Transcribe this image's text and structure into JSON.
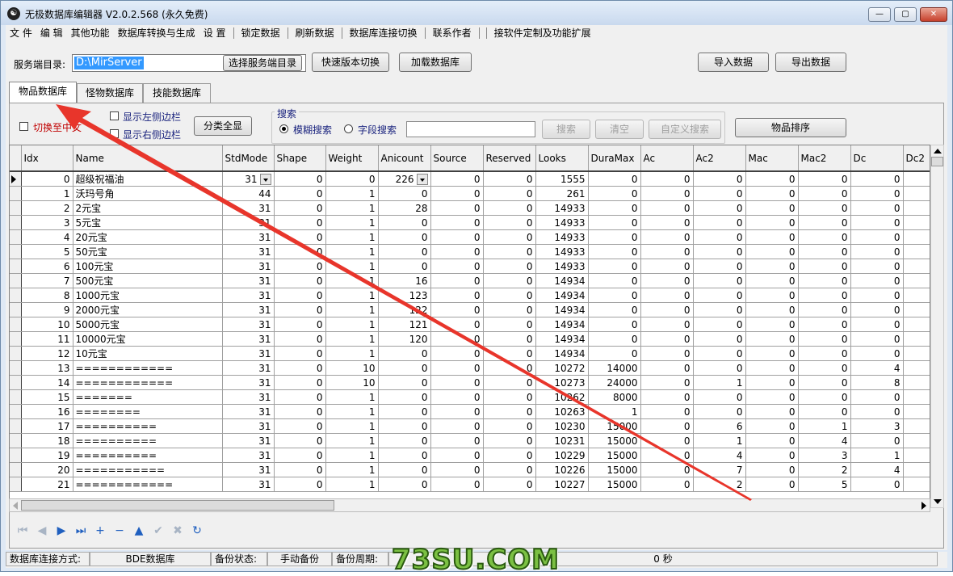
{
  "window": {
    "title": "无极数据库编辑器 V2.0.2.568 (永久免费)",
    "icon_glyph": "☯",
    "min": "—",
    "max": "▢",
    "close": "✕"
  },
  "menu": [
    "文 件",
    "编 辑",
    "其他功能",
    "数据库转换与生成",
    "设 置",
    "|",
    "锁定数据",
    "|",
    "刷新数据",
    "|",
    "数据库连接切换",
    "|",
    "联系作者",
    "|",
    "|",
    "接软件定制及功能扩展"
  ],
  "toolbar": {
    "server_dir_label": "服务端目录:",
    "server_dir_value": "D:\\MirServer",
    "choose_dir": "选择服务端目录",
    "quick_switch": "快速版本切换",
    "load_db": "加载数据库",
    "import": "导入数据",
    "export": "导出数据"
  },
  "tabs": [
    "物品数据库",
    "怪物数据库",
    "技能数据库"
  ],
  "options": {
    "to_chinese": "切换至中文",
    "show_left": "显示左侧边栏",
    "show_right": "显示右侧边栏",
    "show_all": "分类全显"
  },
  "search": {
    "group": "搜索",
    "fuzzy": "模糊搜索",
    "field": "字段搜索",
    "search_btn": "搜索",
    "clear_btn": "清空",
    "custom_btn": "自定义搜索",
    "sort_btn": "物品排序"
  },
  "columns": [
    "Idx",
    "Name",
    "StdMode",
    "Shape",
    "Weight",
    "Anicount",
    "Source",
    "Reserved",
    "Looks",
    "DuraMax",
    "Ac",
    "Ac2",
    "Mac",
    "Mac2",
    "Dc",
    "Dc2"
  ],
  "rows": [
    [
      0,
      "超级祝福油",
      31,
      0,
      0,
      226,
      0,
      0,
      1555,
      0,
      0,
      0,
      0,
      0,
      0
    ],
    [
      1,
      "沃玛号角",
      44,
      0,
      1,
      0,
      0,
      0,
      261,
      0,
      0,
      0,
      0,
      0,
      0
    ],
    [
      2,
      "2元宝",
      31,
      0,
      1,
      28,
      0,
      0,
      14933,
      0,
      0,
      0,
      0,
      0,
      0
    ],
    [
      3,
      "5元宝",
      31,
      0,
      1,
      0,
      0,
      0,
      14933,
      0,
      0,
      0,
      0,
      0,
      0
    ],
    [
      4,
      "20元宝",
      31,
      0,
      1,
      0,
      0,
      0,
      14933,
      0,
      0,
      0,
      0,
      0,
      0
    ],
    [
      5,
      "50元宝",
      31,
      0,
      1,
      0,
      0,
      0,
      14933,
      0,
      0,
      0,
      0,
      0,
      0
    ],
    [
      6,
      "100元宝",
      31,
      0,
      1,
      0,
      0,
      0,
      14933,
      0,
      0,
      0,
      0,
      0,
      0
    ],
    [
      7,
      "500元宝",
      31,
      0,
      1,
      16,
      0,
      0,
      14934,
      0,
      0,
      0,
      0,
      0,
      0
    ],
    [
      8,
      "1000元宝",
      31,
      0,
      1,
      123,
      0,
      0,
      14934,
      0,
      0,
      0,
      0,
      0,
      0
    ],
    [
      9,
      "2000元宝",
      31,
      0,
      1,
      122,
      0,
      0,
      14934,
      0,
      0,
      0,
      0,
      0,
      0
    ],
    [
      10,
      "5000元宝",
      31,
      0,
      1,
      121,
      0,
      0,
      14934,
      0,
      0,
      0,
      0,
      0,
      0
    ],
    [
      11,
      "10000元宝",
      31,
      0,
      1,
      120,
      0,
      0,
      14934,
      0,
      0,
      0,
      0,
      0,
      0
    ],
    [
      12,
      "10元宝",
      31,
      0,
      1,
      0,
      0,
      0,
      14934,
      0,
      0,
      0,
      0,
      0,
      0
    ],
    [
      13,
      "============",
      31,
      0,
      10,
      0,
      0,
      0,
      10272,
      14000,
      0,
      0,
      0,
      0,
      4
    ],
    [
      14,
      "============",
      31,
      0,
      10,
      0,
      0,
      0,
      10273,
      24000,
      0,
      1,
      0,
      0,
      8
    ],
    [
      15,
      "=======",
      31,
      0,
      1,
      0,
      0,
      0,
      10262,
      8000,
      0,
      0,
      0,
      0,
      0
    ],
    [
      16,
      "========",
      31,
      0,
      1,
      0,
      0,
      0,
      10263,
      1,
      0,
      0,
      0,
      0,
      0
    ],
    [
      17,
      "==========",
      31,
      0,
      1,
      0,
      0,
      0,
      10230,
      15000,
      0,
      6,
      0,
      1,
      3
    ],
    [
      18,
      "==========",
      31,
      0,
      1,
      0,
      0,
      0,
      10231,
      15000,
      0,
      1,
      0,
      4,
      0
    ],
    [
      19,
      "==========",
      31,
      0,
      1,
      0,
      0,
      0,
      10229,
      15000,
      0,
      4,
      0,
      3,
      1
    ],
    [
      20,
      "===========",
      31,
      0,
      1,
      0,
      0,
      0,
      10226,
      15000,
      0,
      7,
      0,
      2,
      4
    ],
    [
      21,
      "============",
      31,
      0,
      1,
      0,
      0,
      0,
      10227,
      15000,
      0,
      2,
      0,
      5,
      0
    ]
  ],
  "nav_icons": [
    "first-icon",
    "prior-icon",
    "next-icon",
    "last-icon",
    "insert-icon",
    "delete-icon",
    "edit-icon",
    "post-icon",
    "cancel-icon",
    "refresh-icon"
  ],
  "nav_glyphs": [
    "⏮",
    "◀",
    "▶",
    "⏭",
    "+",
    "−",
    "▲",
    "✔",
    "✖",
    "↻"
  ],
  "status": {
    "conn_label": "数据库连接方式:",
    "conn_value": "BDE数据库",
    "backup_label": "备份状态:",
    "backup_value": "手动备份",
    "period_label": "备份周期:",
    "period_value": "0 秒"
  },
  "watermark": "73SU.COM",
  "accent": "#3399ff",
  "annotation_color": "#e8352b"
}
